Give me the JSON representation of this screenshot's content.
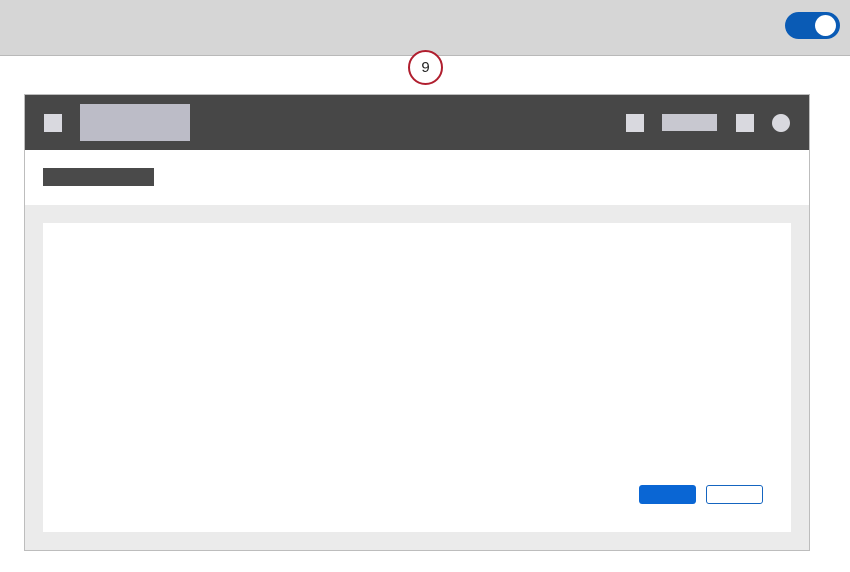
{
  "step_badge": {
    "number": "9",
    "color": "#b01e2e"
  },
  "toggle": {
    "state": "on",
    "color": "#0a5bb5"
  },
  "colors": {
    "app_bar": "#474747",
    "primary": "#0a66d4",
    "background": "#ebebeb"
  },
  "icons": {
    "menu": "hamburger-placeholder",
    "logo": "logo-placeholder",
    "header_icon_1": "icon-placeholder",
    "header_link": "nav-link-placeholder",
    "header_icon_2": "icon-placeholder",
    "avatar": "avatar-placeholder"
  }
}
